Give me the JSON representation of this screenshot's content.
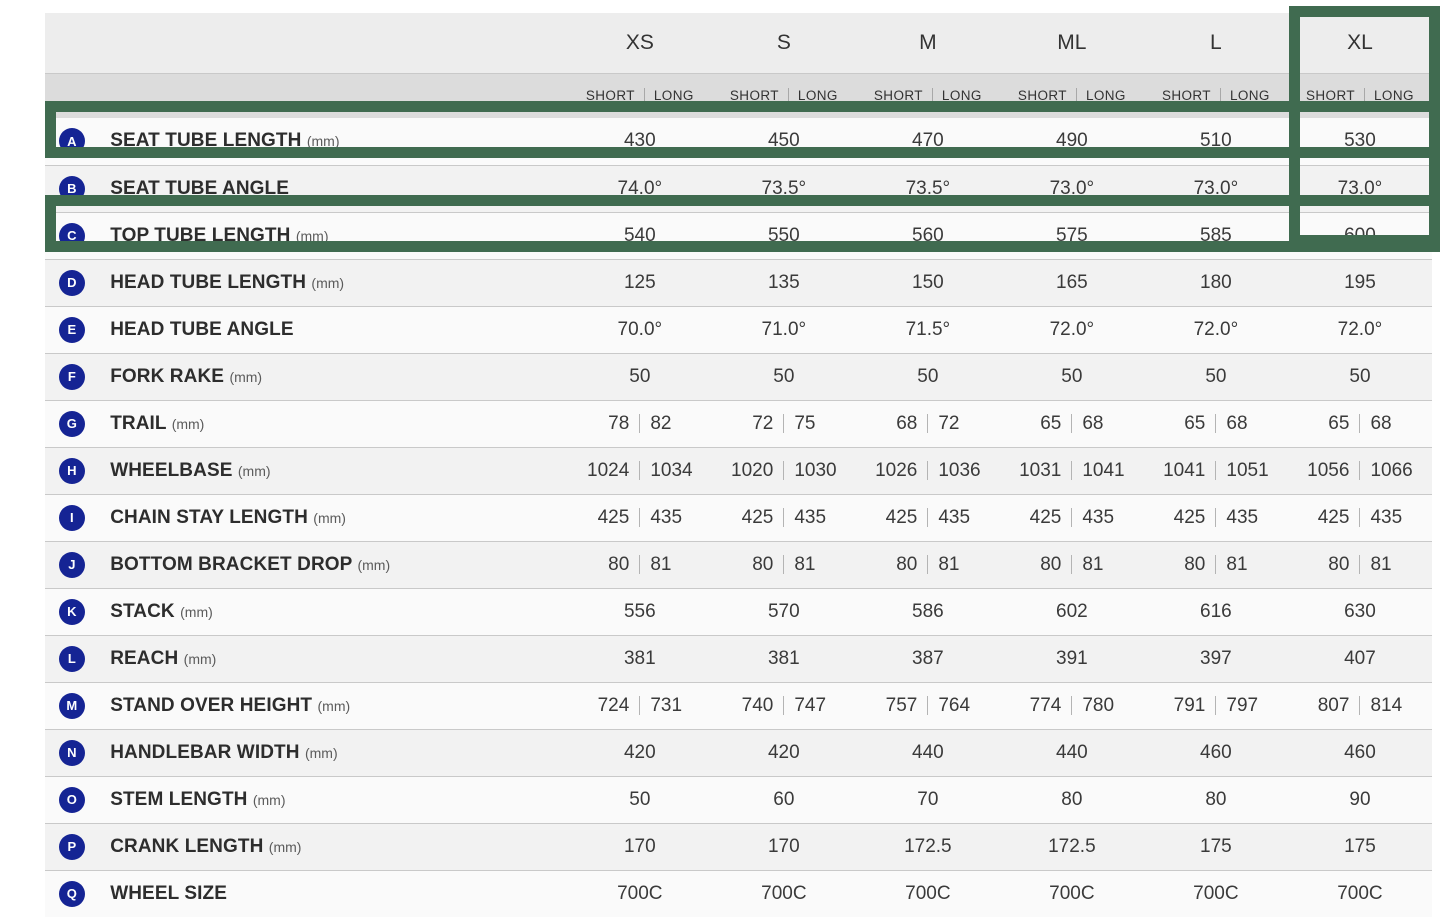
{
  "table": {
    "size_header_blank": "",
    "sizes": [
      "XS",
      "S",
      "M",
      "ML",
      "L",
      "XL"
    ],
    "subheader": {
      "short": "SHORT",
      "long": "LONG"
    },
    "rows": [
      {
        "badge": "A",
        "label": "SEAT TUBE LENGTH",
        "unit": "(mm)",
        "split": false,
        "values": [
          "430",
          "450",
          "470",
          "490",
          "510",
          "530"
        ]
      },
      {
        "badge": "B",
        "label": "SEAT TUBE ANGLE",
        "unit": "",
        "split": false,
        "values": [
          "74.0°",
          "73.5°",
          "73.5°",
          "73.0°",
          "73.0°",
          "73.0°"
        ]
      },
      {
        "badge": "C",
        "label": "TOP TUBE LENGTH",
        "unit": "(mm)",
        "split": false,
        "values": [
          "540",
          "550",
          "560",
          "575",
          "585",
          "600"
        ]
      },
      {
        "badge": "D",
        "label": "HEAD TUBE LENGTH",
        "unit": "(mm)",
        "split": false,
        "values": [
          "125",
          "135",
          "150",
          "165",
          "180",
          "195"
        ]
      },
      {
        "badge": "E",
        "label": "HEAD TUBE ANGLE",
        "unit": "",
        "split": false,
        "values": [
          "70.0°",
          "71.0°",
          "71.5°",
          "72.0°",
          "72.0°",
          "72.0°"
        ]
      },
      {
        "badge": "F",
        "label": "FORK RAKE",
        "unit": "(mm)",
        "split": false,
        "values": [
          "50",
          "50",
          "50",
          "50",
          "50",
          "50"
        ]
      },
      {
        "badge": "G",
        "label": "TRAIL",
        "unit": "(mm)",
        "split": true,
        "values": [
          [
            "78",
            "82"
          ],
          [
            "72",
            "75"
          ],
          [
            "68",
            "72"
          ],
          [
            "65",
            "68"
          ],
          [
            "65",
            "68"
          ],
          [
            "65",
            "68"
          ]
        ]
      },
      {
        "badge": "H",
        "label": "WHEELBASE",
        "unit": "(mm)",
        "split": true,
        "values": [
          [
            "1024",
            "1034"
          ],
          [
            "1020",
            "1030"
          ],
          [
            "1026",
            "1036"
          ],
          [
            "1031",
            "1041"
          ],
          [
            "1041",
            "1051"
          ],
          [
            "1056",
            "1066"
          ]
        ]
      },
      {
        "badge": "I",
        "label": "CHAIN STAY LENGTH",
        "unit": "(mm)",
        "split": true,
        "values": [
          [
            "425",
            "435"
          ],
          [
            "425",
            "435"
          ],
          [
            "425",
            "435"
          ],
          [
            "425",
            "435"
          ],
          [
            "425",
            "435"
          ],
          [
            "425",
            "435"
          ]
        ]
      },
      {
        "badge": "J",
        "label": "BOTTOM BRACKET DROP",
        "unit": "(mm)",
        "split": true,
        "values": [
          [
            "80",
            "81"
          ],
          [
            "80",
            "81"
          ],
          [
            "80",
            "81"
          ],
          [
            "80",
            "81"
          ],
          [
            "80",
            "81"
          ],
          [
            "80",
            "81"
          ]
        ]
      },
      {
        "badge": "K",
        "label": "STACK",
        "unit": "(mm)",
        "split": false,
        "values": [
          "556",
          "570",
          "586",
          "602",
          "616",
          "630"
        ]
      },
      {
        "badge": "L",
        "label": "REACH",
        "unit": "(mm)",
        "split": false,
        "values": [
          "381",
          "381",
          "387",
          "391",
          "397",
          "407"
        ]
      },
      {
        "badge": "M",
        "label": "STAND OVER HEIGHT",
        "unit": "(mm)",
        "split": true,
        "values": [
          [
            "724",
            "731"
          ],
          [
            "740",
            "747"
          ],
          [
            "757",
            "764"
          ],
          [
            "774",
            "780"
          ],
          [
            "791",
            "797"
          ],
          [
            "807",
            "814"
          ]
        ]
      },
      {
        "badge": "N",
        "label": "HANDLEBAR WIDTH",
        "unit": "(mm)",
        "split": false,
        "values": [
          "420",
          "420",
          "440",
          "440",
          "460",
          "460"
        ]
      },
      {
        "badge": "O",
        "label": "STEM LENGTH",
        "unit": "(mm)",
        "split": false,
        "values": [
          "50",
          "60",
          "70",
          "80",
          "80",
          "90"
        ]
      },
      {
        "badge": "P",
        "label": "CRANK LENGTH",
        "unit": "(mm)",
        "split": false,
        "values": [
          "170",
          "170",
          "172.5",
          "172.5",
          "175",
          "175"
        ]
      },
      {
        "badge": "Q",
        "label": "WHEEL SIZE",
        "unit": "",
        "split": false,
        "values": [
          "700C",
          "700C",
          "700C",
          "700C",
          "700C",
          "700C"
        ]
      }
    ]
  },
  "highlights": [
    {
      "name": "column-xl",
      "target": "XL column"
    },
    {
      "name": "row-a",
      "target": "SEAT TUBE LENGTH row"
    },
    {
      "name": "row-c",
      "target": "TOP TUBE LENGTH row"
    }
  ],
  "colors": {
    "highlight_green": "#406b50",
    "badge_navy": "#152494",
    "header_top": "#ededed",
    "header_sub": "#dcdcdc",
    "row_light": "#fafafa",
    "row_alt": "#f2f2f2"
  }
}
